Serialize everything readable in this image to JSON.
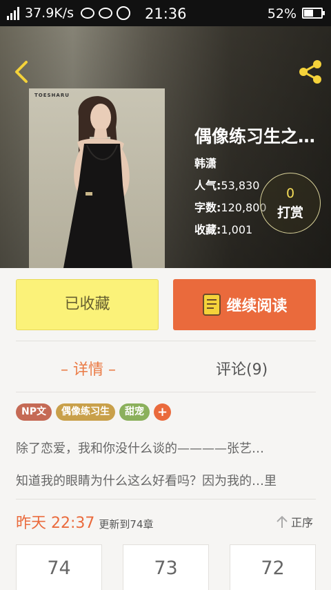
{
  "status_bar": {
    "network": "4G",
    "speed": "37.9K/s",
    "time": "21:36",
    "battery": "52%"
  },
  "book": {
    "cover_text": "TOESHARU",
    "title": "偶像练习生之…",
    "author": "韩潇",
    "popularity_label": "人气:",
    "popularity": "53,830",
    "words_label": "字数:",
    "words": "120,800",
    "favorites_label": "收藏:",
    "favorites": "1,001"
  },
  "tip": {
    "count": "0",
    "label": "打赏"
  },
  "actions": {
    "favorited_label": "已收藏",
    "continue_label": "继续阅读"
  },
  "tabs": {
    "details": "– 详情 –",
    "comments": "评论(9)"
  },
  "tags": [
    {
      "label": "NP文",
      "color": "#c56a55"
    },
    {
      "label": "偶像练习生",
      "color": "#c9a04a"
    },
    {
      "label": "甜宠",
      "color": "#8bb05c"
    }
  ],
  "tag_add_label": "+",
  "description": {
    "line1": "除了恋爱，我和你没什么谈的————张艺…",
    "line2": "知道我的眼睛为什么这么好看吗？因为我的…里"
  },
  "update": {
    "time": "昨天 22:37",
    "note": "更新到74章",
    "sort_label": "正序"
  },
  "chapters": [
    "74",
    "73",
    "72"
  ],
  "colors": {
    "accent": "#ea6a3c",
    "favorite_bg": "#fbf279",
    "tip_gold": "#f5dd58"
  }
}
